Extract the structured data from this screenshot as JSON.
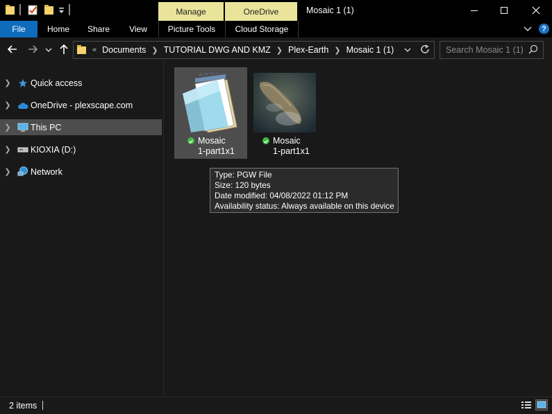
{
  "window": {
    "title": "Mosaic 1 (1)",
    "quick_access_icons": [
      "folder-icon",
      "properties-icon",
      "new-folder-icon"
    ],
    "controls": [
      "minimize",
      "maximize",
      "close"
    ]
  },
  "ribbon": {
    "file_tab": "File",
    "tabs": [
      "Home",
      "Share",
      "View"
    ],
    "context_groups": [
      {
        "header": "Manage",
        "tab": "Picture Tools"
      },
      {
        "header": "OneDrive",
        "tab": "Cloud Storage"
      }
    ],
    "help_label": "?"
  },
  "address_bar": {
    "overflow": "«",
    "breadcrumbs": [
      "Documents",
      "TUTORIAL DWG AND KMZ",
      "Plex-Earth",
      "Mosaic 1 (1)"
    ],
    "search_placeholder": "Search Mosaic 1 (1)"
  },
  "nav_pane": {
    "items": [
      {
        "label": "Quick access",
        "icon": "star-icon"
      },
      {
        "label": "OneDrive - plexscape.com",
        "icon": "cloud-icon"
      },
      {
        "label": "This PC",
        "icon": "computer-icon",
        "selected": true
      },
      {
        "label": "KIOXIA (D:)",
        "icon": "drive-icon"
      },
      {
        "label": "Network",
        "icon": "network-icon"
      }
    ]
  },
  "files": [
    {
      "line1": "Mosaic",
      "line2": "1-part1x1",
      "type": "notepad",
      "status": "available",
      "selected": true
    },
    {
      "line1": "Mosaic",
      "line2": "1-part1x1",
      "type": "image",
      "status": "available",
      "selected": false
    }
  ],
  "tooltip": {
    "type": "Type: PGW File",
    "size": "Size: 120 bytes",
    "date": "Date modified: 04/08/2022 01:12 PM",
    "availability": "Availability status: Always available on this device"
  },
  "status_bar": {
    "item_count": "2 items"
  },
  "colors": {
    "context_tab": "#e9e49a",
    "file_tab": "#0f6cbd",
    "selection": "#4d4d4d",
    "status_ok": "#3dbb45"
  }
}
